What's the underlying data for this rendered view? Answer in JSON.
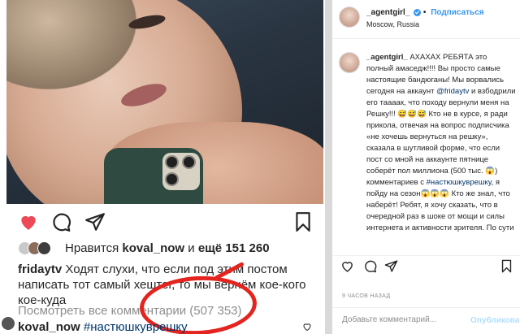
{
  "post": {
    "likes": {
      "prefix": "Нравится",
      "user": "koval_now",
      "middle": "и",
      "count": "ещё 151 260"
    },
    "caption": {
      "user": "fridaytv",
      "text": "Ходят слухи, что если под этим постом написать тот самый хештег, то мы вернём кое-кого кое-куда"
    },
    "view_all": "Посмотреть все комментарии (507 353)",
    "first_comment": {
      "user": "koval_now",
      "text": "#настюшкуврешку"
    }
  },
  "panel": {
    "username": "_agentgirl_",
    "follow_label": "Подписаться",
    "location": "Moscow, Russia",
    "comment_user": "_agentgirl_",
    "comment_part1": "АХАХАХ РЕБЯТА это полный амаседж!!!! Вы просто самые настоящие бандюганы! Мы ворвались сегодня на аккаунт ",
    "comment_mention": "@fridaytv",
    "comment_part2": " и взбодрили его таааак, что походу вернули меня на Решку!!! 😅😅😅 Кто не в курсе, я ради прикола, отвечая на вопрос подписчика «не хочешь вернуться на решку», сказала в шутливой форме, что если пост со мной на аккаунте пятнице соберёт пол миллиона (500 тыс. 😱) комментариев с ",
    "comment_hashtag": "#настюшкуврешку",
    "comment_part3": ", я пойду на сезон😱😱😱 Кто же знал, что наберёт! Ребят, я хочу сказать, что в очередной раз в шоке от мощи и силы интернета и активности зрителя. По сути",
    "time": "9 ЧАСОВ НАЗАД",
    "input_placeholder": "Добавьте комментарий...",
    "publish_label": "Опубликовать"
  },
  "colors": {
    "accent": "#3897f0",
    "heart": "#ed4956",
    "annotation": "#e3241f"
  }
}
